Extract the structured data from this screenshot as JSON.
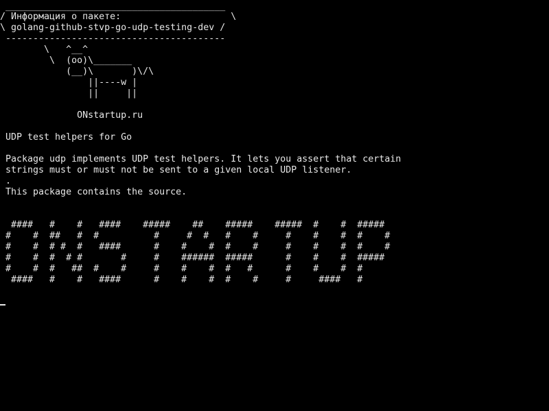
{
  "terminal": {
    "speech_bubble": {
      "top_border": " ________________________________________",
      "title_line": "/ Информация о пакете:                    \\",
      "package_line": "\\ golang-github-stvp-go-udp-testing-dev /",
      "bottom_border": " ----------------------------------------"
    },
    "cow_art": [
      "        \\   ^__^",
      "         \\  (oo)\\_______",
      "            (__)\\       )\\/\\",
      "                ||----w |",
      "                ||     ||"
    ],
    "site": "              ONstartup.ru",
    "package_summary": " UDP test helpers for Go",
    "package_description": [
      " Package udp implements UDP test helpers. It lets you assert that certain",
      " strings must or must not be sent to a given local UDP listener.",
      " .",
      " This package contains the source."
    ],
    "banner": [
      "  ####   #    #   ####    #####    ##    #####    #####  #    #  #####",
      " #    #  ##   #  #          #     #  #   #    #     #    #    #  #    #",
      " #    #  # #  #   ####      #    #    #  #    #     #    #    #  #    #",
      " #    #  #  # #       #     #    ######  #####      #    #    #  #####",
      " #    #  #   ##  #    #     #    #    #  #   #      #    #    #  #",
      "  ####   #    #   ####      #    #    #  #    #     #     ####   #"
    ]
  }
}
